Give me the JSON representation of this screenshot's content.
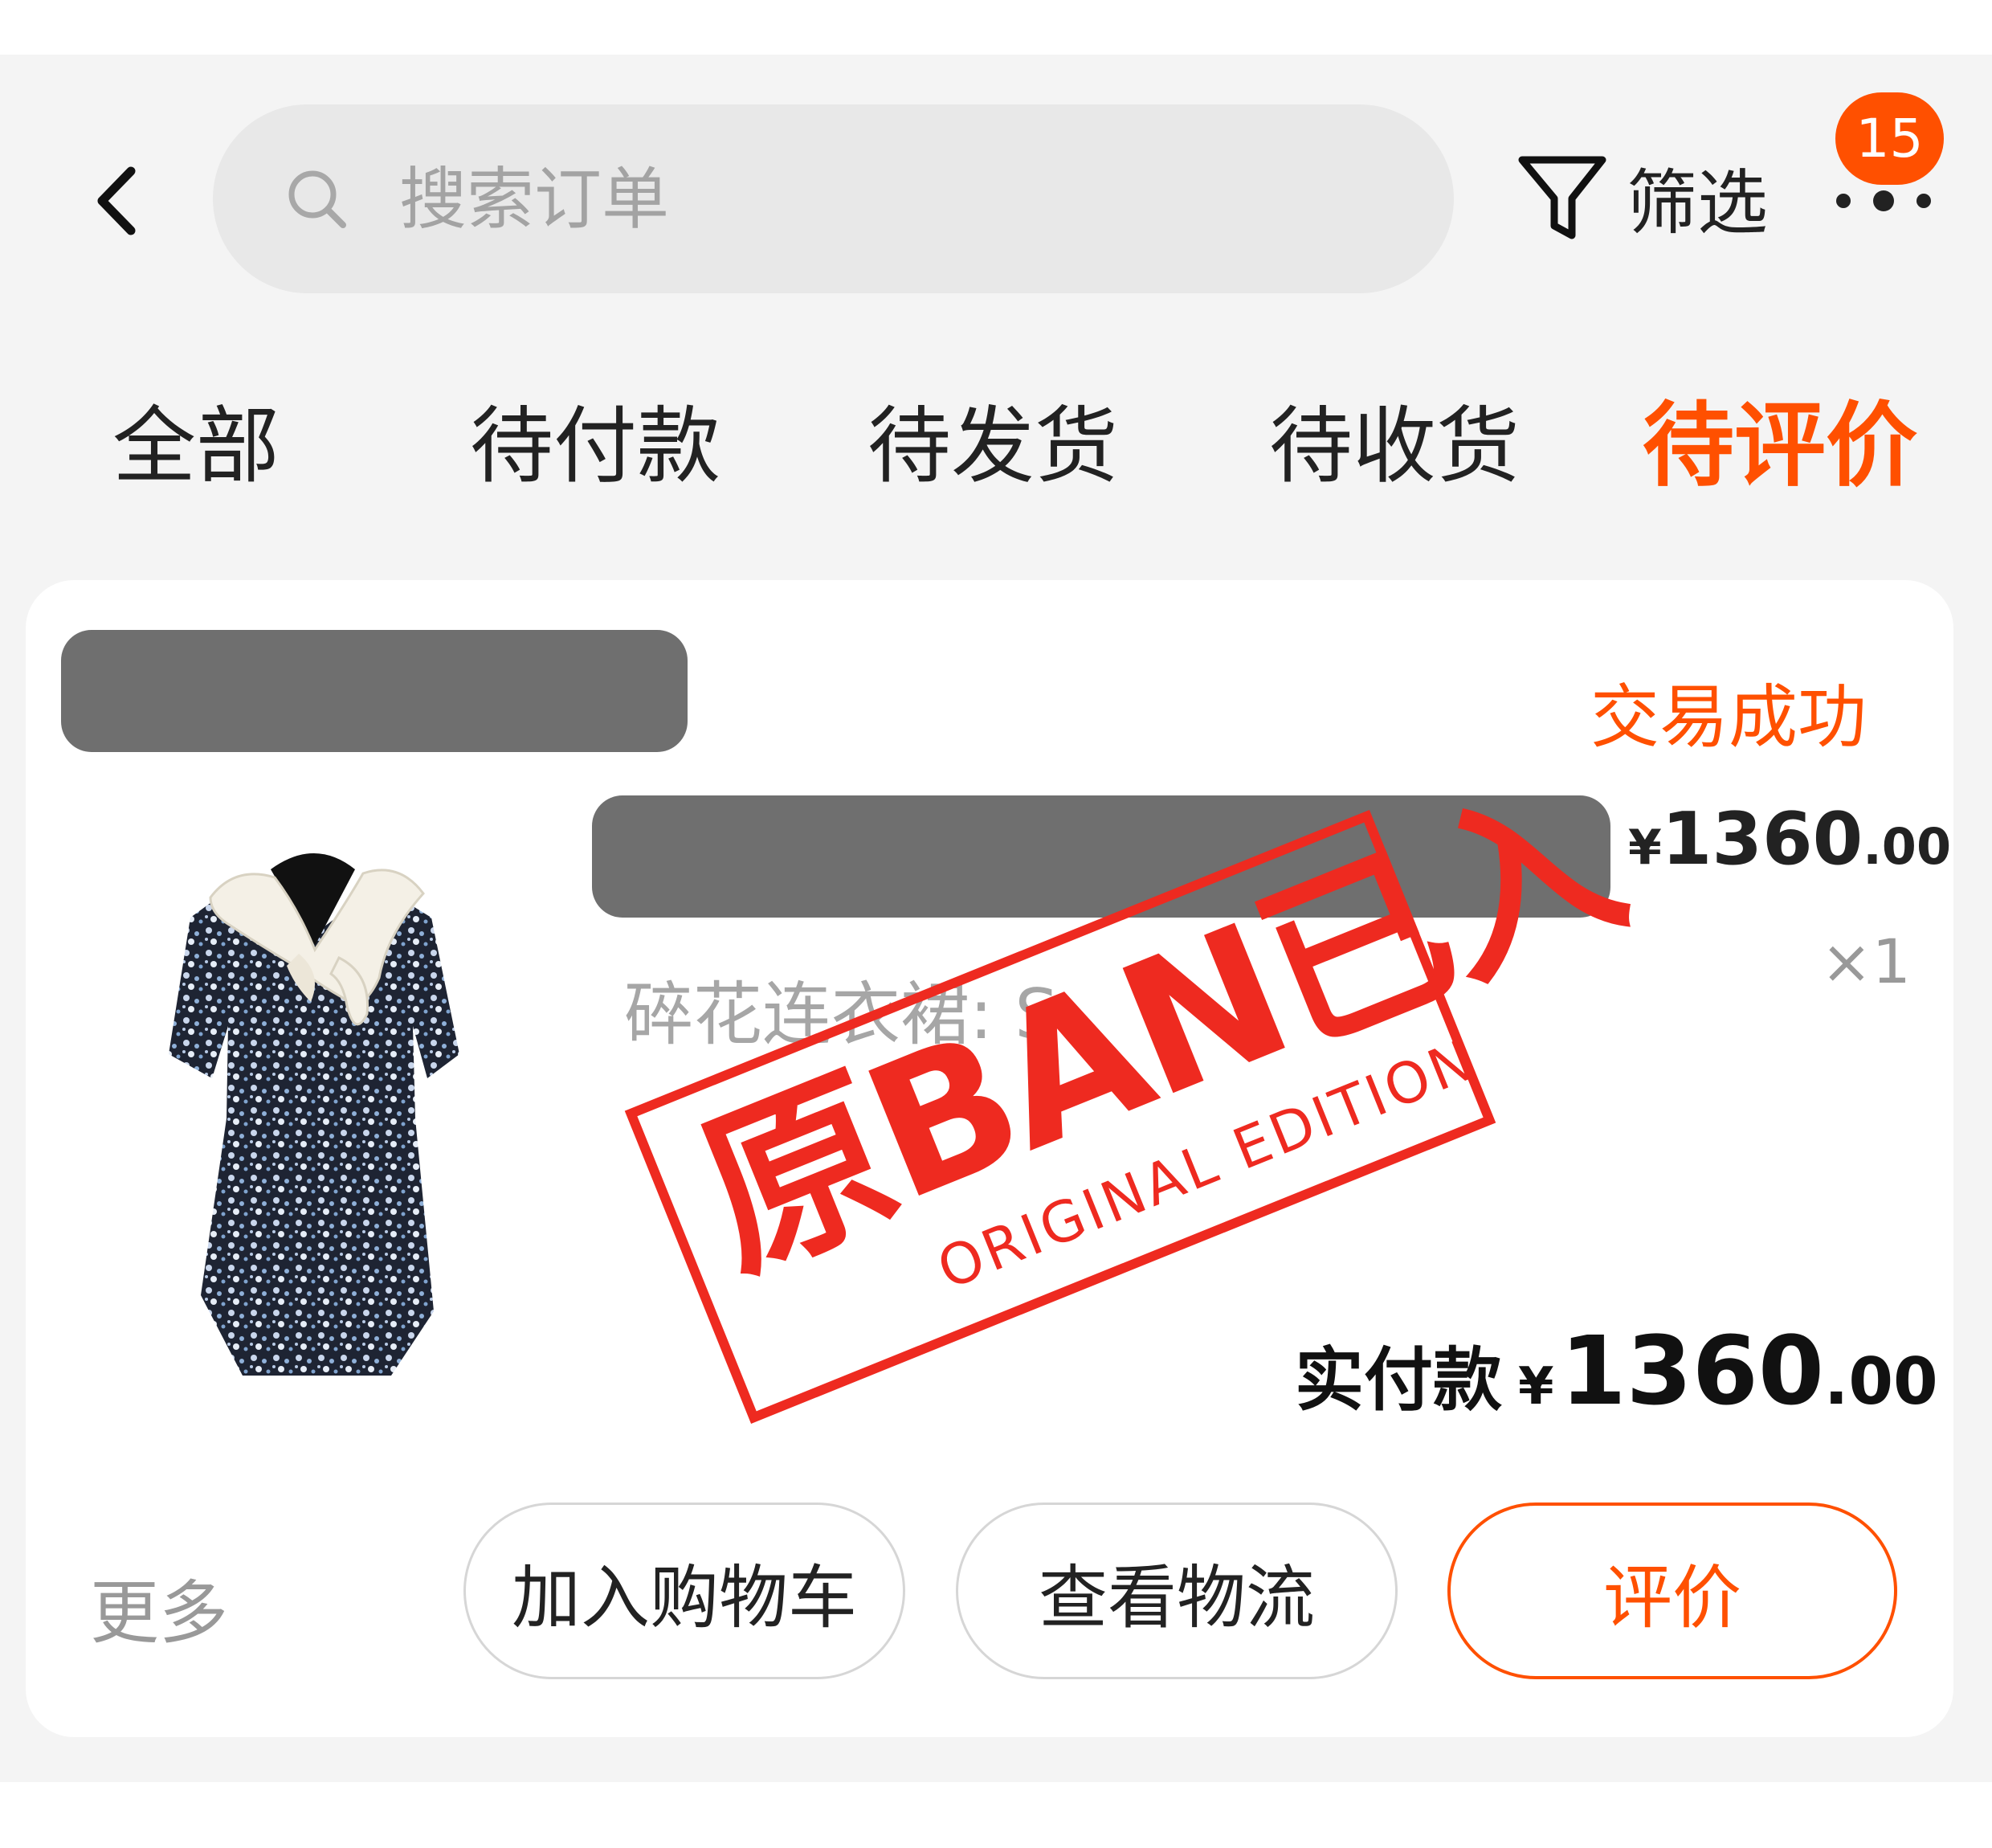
{
  "header": {
    "search_placeholder": "搜索订单",
    "filter_label": "筛选",
    "notification_count": "15"
  },
  "tabs": [
    {
      "label": "全部",
      "active": false
    },
    {
      "label": "待付款",
      "active": false
    },
    {
      "label": "待发货",
      "active": false
    },
    {
      "label": "待收货",
      "active": false
    },
    {
      "label": "待评价",
      "active": true
    }
  ],
  "order": {
    "status": "交易成功",
    "item": {
      "spec": "碎花连衣裙: S",
      "unit_price": {
        "currency": "¥",
        "integer": "1360",
        "decimal": ".00"
      },
      "quantity": "×1"
    },
    "paid": {
      "label": "实付款",
      "currency": "¥",
      "integer": "1360",
      "decimal": ".00"
    },
    "more_label": "更多",
    "actions": {
      "add_to_cart": "加入购物车",
      "view_logistics": "查看物流",
      "review": "评价"
    }
  },
  "stamp": {
    "main": "原BAN已入",
    "sub": "ORIGINAL EDITION"
  },
  "colors": {
    "accent": "#ff5000",
    "stamp_red": "#ee2a20",
    "background": "#f4f4f4",
    "card": "#ffffff"
  }
}
